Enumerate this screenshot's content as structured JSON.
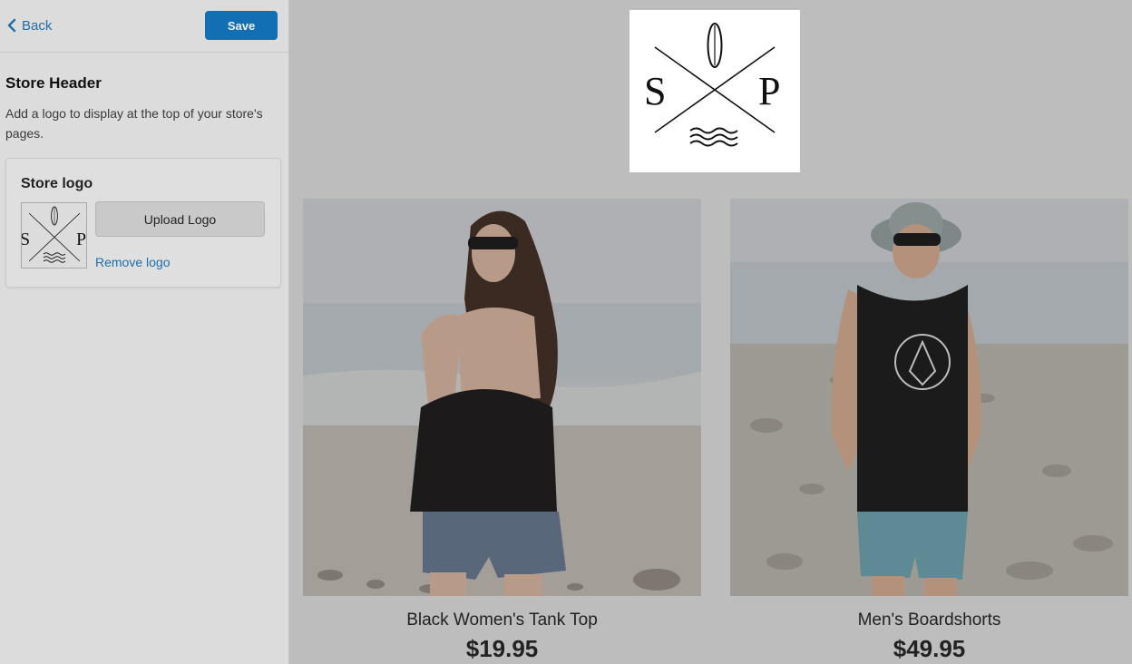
{
  "topbar": {
    "back_label": "Back",
    "save_label": "Save"
  },
  "store_header": {
    "title": "Store Header",
    "description": "Add a logo to display at the top of your store's pages."
  },
  "logo_card": {
    "title": "Store logo",
    "upload_label": "Upload Logo",
    "remove_label": "Remove logo"
  },
  "store_logo": {
    "letter_left": "S",
    "letter_right": "P",
    "icon_top": "surfboard-icon",
    "icon_bottom": "waves-icon"
  },
  "products": [
    {
      "name": "Black Women's Tank Top",
      "price": "$19.95",
      "image": "woman-on-beach-photo"
    },
    {
      "name": "Men's Boardshorts",
      "price": "$49.95",
      "image": "man-on-beach-photo"
    }
  ],
  "colors": {
    "accent": "#136fb4",
    "link": "#1f6ea8",
    "overlay": "#bdbdbd"
  }
}
